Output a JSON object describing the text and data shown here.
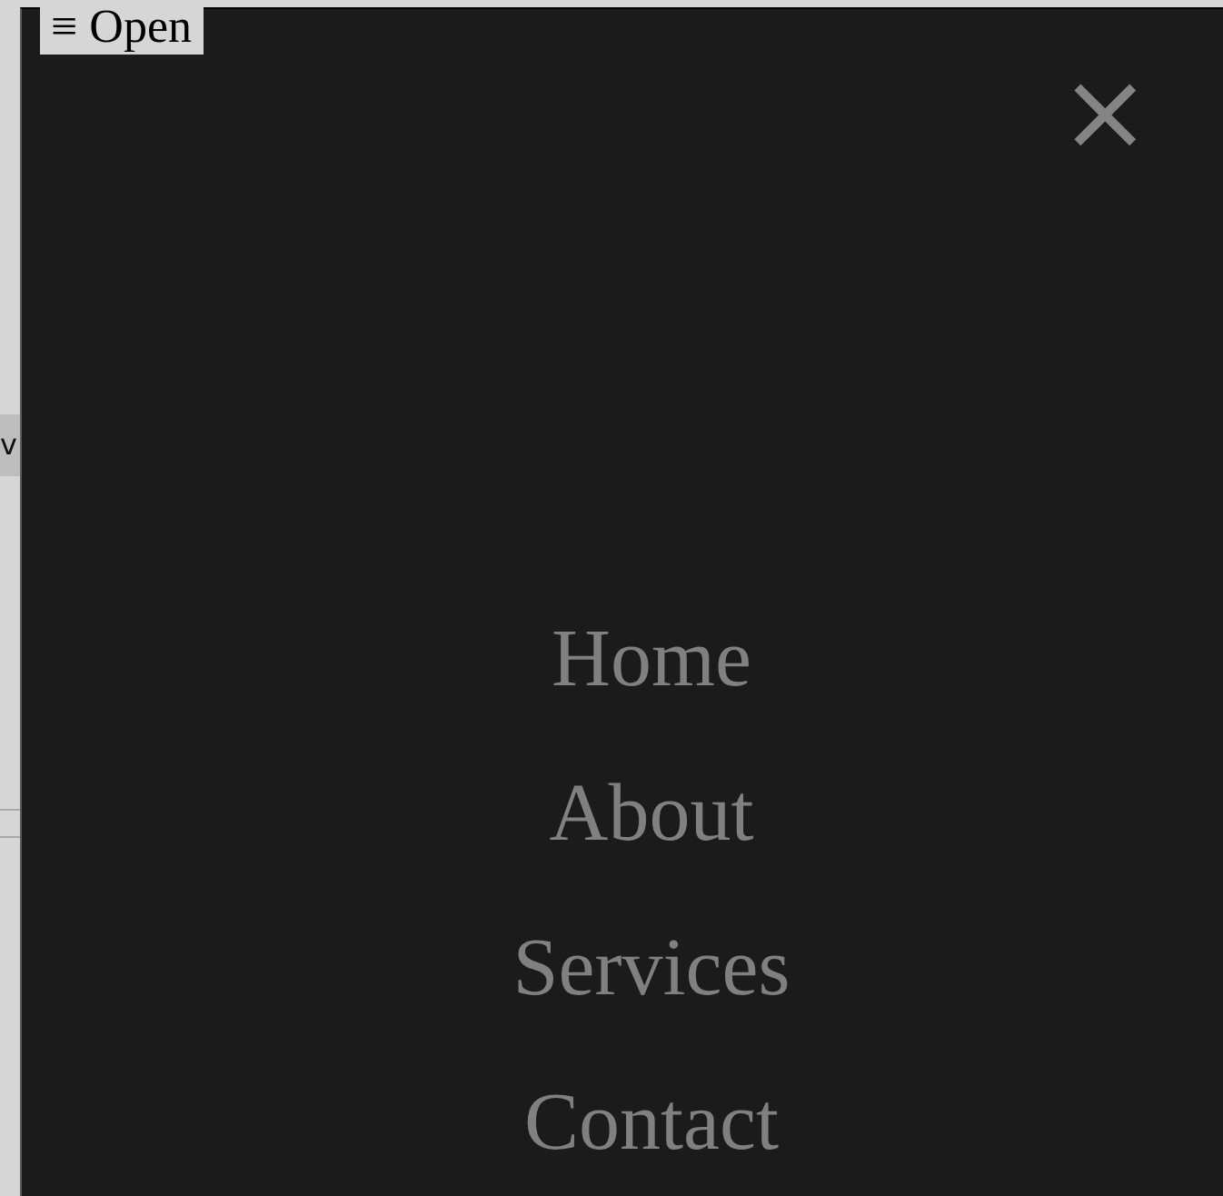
{
  "page": {
    "open_button": {
      "icon": "≡",
      "label": "Open"
    },
    "side_tab": "v"
  },
  "overlay": {
    "close": "×",
    "menu": [
      {
        "label": "Home"
      },
      {
        "label": "About"
      },
      {
        "label": "Services"
      },
      {
        "label": "Contact"
      }
    ]
  }
}
